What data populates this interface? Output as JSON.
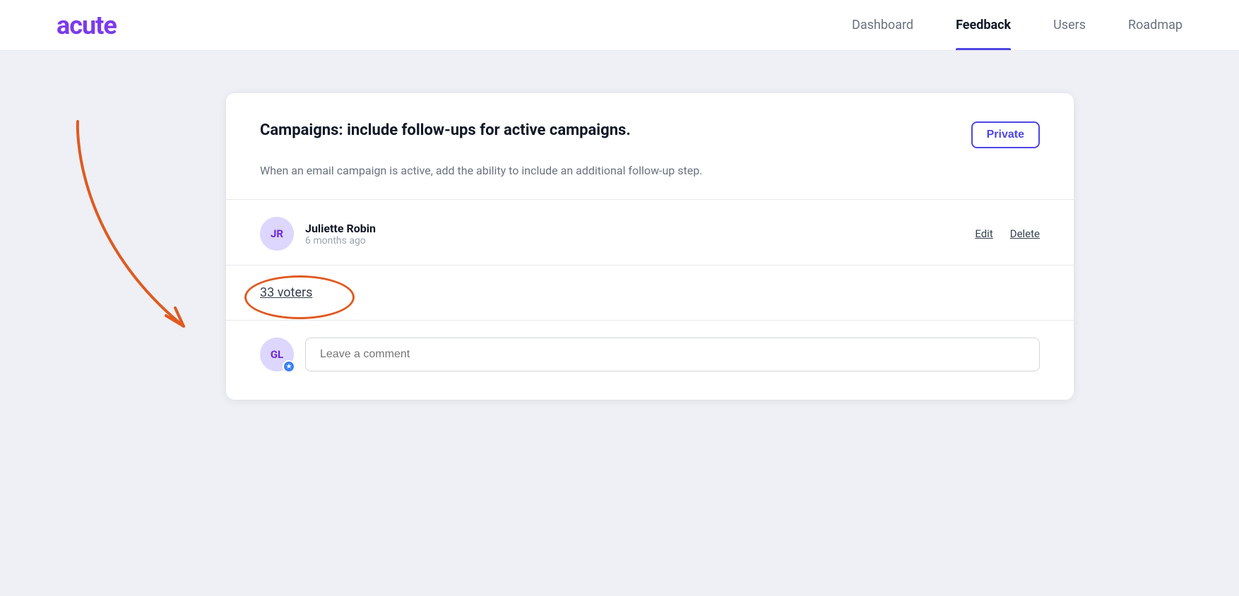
{
  "app": {
    "logo": "acute"
  },
  "nav": {
    "items": [
      {
        "id": "dashboard",
        "label": "Dashboard",
        "active": false
      },
      {
        "id": "feedback",
        "label": "Feedback",
        "active": true
      },
      {
        "id": "users",
        "label": "Users",
        "active": false
      },
      {
        "id": "roadmap",
        "label": "Roadmap",
        "active": false
      }
    ]
  },
  "card": {
    "title": "Campaigns: include follow-ups for active campaigns.",
    "description": "When an email campaign is active, add the ability to include an additional follow-up step.",
    "private_button": "Private",
    "author": {
      "initials": "JR",
      "name": "Juliette Robin",
      "time": "6 months ago"
    },
    "edit_label": "Edit",
    "delete_label": "Delete",
    "voters": {
      "count": "33",
      "label": "33 voters"
    },
    "comment": {
      "author_initials": "GL",
      "placeholder": "Leave a comment"
    }
  }
}
